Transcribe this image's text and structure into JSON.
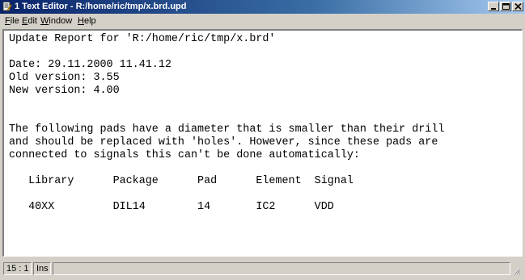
{
  "window": {
    "title": "1 Text Editor - R:/home/ric/tmp/x.brd.upd",
    "icon": "text-editor-icon"
  },
  "menu": {
    "items": [
      {
        "label": "File",
        "mnemonic": "F",
        "rest": "ile"
      },
      {
        "label": "Edit",
        "mnemonic": "E",
        "rest": "dit"
      },
      {
        "label": "Window",
        "mnemonic": "W",
        "rest": "indow"
      },
      {
        "label": "Help",
        "mnemonic": "H",
        "rest": "elp"
      }
    ]
  },
  "editor": {
    "lines": [
      "Update Report for 'R:/home/ric/tmp/x.brd'",
      "",
      "Date: 29.11.2000 11.41.12",
      "Old version: 3.55",
      "New version: 4.00",
      "",
      "",
      "The following pads have a diameter that is smaller than their drill",
      "and should be replaced with 'holes'. However, since these pads are",
      "connected to signals this can't be done automatically:",
      "",
      "   Library      Package      Pad      Element  Signal",
      "",
      "   40XX         DIL14        14       IC2      VDD"
    ]
  },
  "status": {
    "position": "15 : 1",
    "mode": "Ins"
  },
  "colors": {
    "titlebar_start": "#0a246a",
    "titlebar_end": "#a6caf0",
    "chrome": "#d4d0c8"
  }
}
